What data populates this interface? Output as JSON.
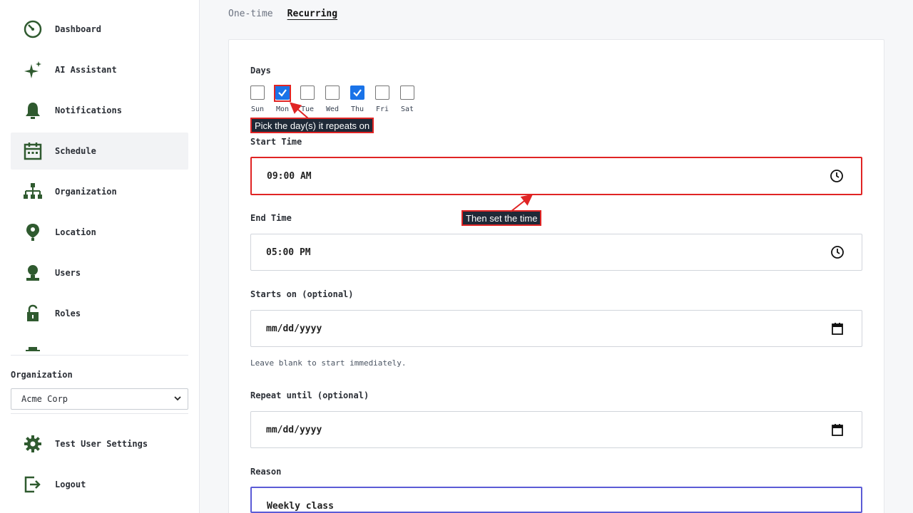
{
  "sidebar": {
    "nav": [
      {
        "label": "Dashboard",
        "icon": "dashboard-icon",
        "active": false
      },
      {
        "label": "AI Assistant",
        "icon": "sparkle-icon",
        "active": false
      },
      {
        "label": "Notifications",
        "icon": "bell-icon",
        "active": false
      },
      {
        "label": "Schedule",
        "icon": "calendar-icon",
        "active": true
      },
      {
        "label": "Organization",
        "icon": "org-chart-icon",
        "active": false
      },
      {
        "label": "Location",
        "icon": "location-pin-icon",
        "active": false
      },
      {
        "label": "Users",
        "icon": "user-icon",
        "active": false
      },
      {
        "label": "Roles",
        "icon": "lock-icon",
        "active": false
      }
    ],
    "org_label": "Organization",
    "org_selected": "Acme Corp",
    "settings_label": "Test User Settings",
    "logout_label": "Logout"
  },
  "tabs": {
    "one_time": "One-time",
    "recurring": "Recurring"
  },
  "form": {
    "days_label": "Days",
    "days": [
      {
        "label": "Sun",
        "checked": false
      },
      {
        "label": "Mon",
        "checked": true
      },
      {
        "label": "Tue",
        "checked": false
      },
      {
        "label": "Wed",
        "checked": false
      },
      {
        "label": "Thu",
        "checked": true
      },
      {
        "label": "Fri",
        "checked": false
      },
      {
        "label": "Sat",
        "checked": false
      }
    ],
    "start_time_label": "Start Time",
    "start_time_value": "09:00 AM",
    "end_time_label": "End Time",
    "end_time_value": "05:00 PM",
    "starts_on_label": "Starts on (optional)",
    "starts_on_placeholder": "mm/dd/yyyy",
    "starts_on_helper": "Leave blank to start immediately.",
    "repeat_until_label": "Repeat until (optional)",
    "repeat_until_placeholder": "mm/dd/yyyy",
    "reason_label": "Reason",
    "reason_value": "Weekly class"
  },
  "annotations": {
    "days_hint": "Pick the day(s) it repeats on",
    "time_hint": "Then set the time"
  },
  "colors": {
    "icon_green": "#2f5a2f",
    "accent_blue": "#1a73e8",
    "annotation_red": "#e02424",
    "focus_purple": "#5b5bd6"
  }
}
